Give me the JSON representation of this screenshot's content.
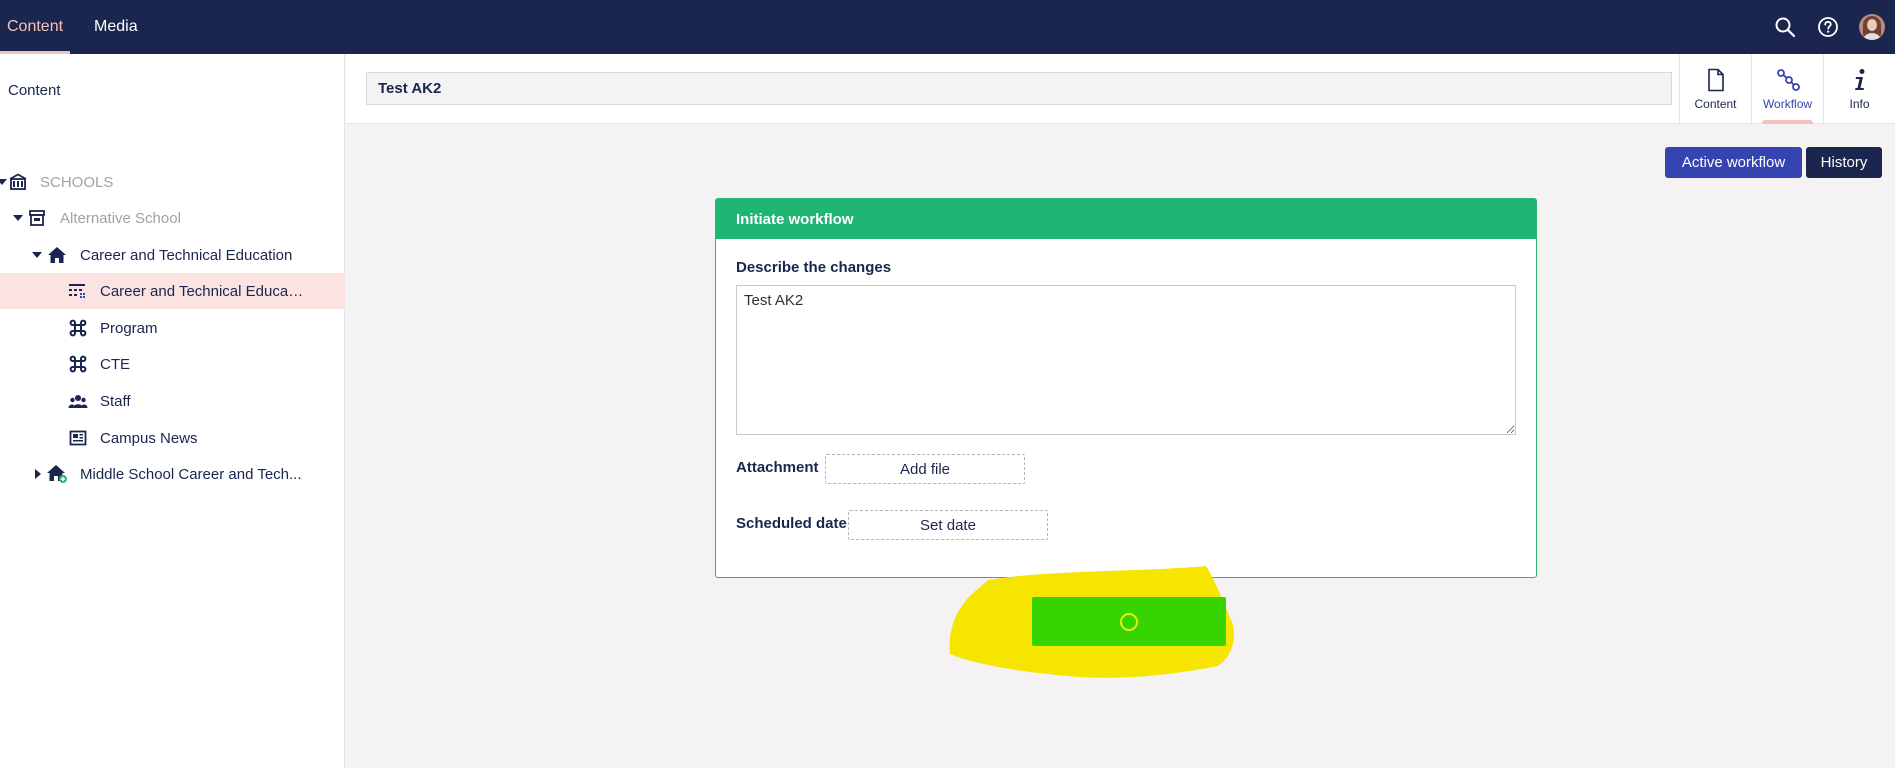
{
  "topnav": {
    "tabs": [
      {
        "label": "Content",
        "active": true
      },
      {
        "label": "Media",
        "active": false
      }
    ],
    "icons": [
      "search-icon",
      "help-icon",
      "avatar"
    ]
  },
  "sidebar": {
    "title": "Content",
    "tree": [
      {
        "label": "SCHOOLS",
        "icon": "school-building-icon",
        "muted": true,
        "expanded": true
      },
      {
        "label": "Alternative School",
        "icon": "store-icon",
        "muted": true,
        "expanded": true
      },
      {
        "label": "Career and Technical Education",
        "icon": "home-icon",
        "expanded": true
      },
      {
        "label": "Career and Technical Educati...",
        "icon": "grid-icon",
        "selected": true
      },
      {
        "label": "Program",
        "icon": "command-icon"
      },
      {
        "label": "CTE",
        "icon": "command-icon"
      },
      {
        "label": "Staff",
        "icon": "users-icon"
      },
      {
        "label": "Campus News",
        "icon": "newspaper-icon"
      },
      {
        "label": "Middle School Career and Tech...",
        "icon": "home-plus-icon",
        "expanded": false
      }
    ]
  },
  "editor": {
    "name_value": "Test AK2",
    "apps": [
      {
        "label": "Content",
        "icon": "document-icon",
        "active": false
      },
      {
        "label": "Workflow",
        "icon": "workflow-icon",
        "active": true
      },
      {
        "label": "Info",
        "icon": "info-icon",
        "active": false
      }
    ],
    "buttons": {
      "active_workflow": "Active workflow",
      "history": "History"
    }
  },
  "workflow_panel": {
    "title": "Initiate workflow",
    "describe_label": "Describe the changes",
    "describe_value": "Test AK2",
    "attachment_label": "Attachment",
    "add_file_label": "Add file",
    "scheduled_label": "Scheduled date",
    "set_date_label": "Set date"
  },
  "colors": {
    "topbar": "#1b264f",
    "accent_pink": "#f5c1bc",
    "workflow_header": "#1fb572",
    "active_workflow_btn": "#3544b1",
    "submit_btn": "#36d400",
    "highlight": "#f5e500"
  }
}
